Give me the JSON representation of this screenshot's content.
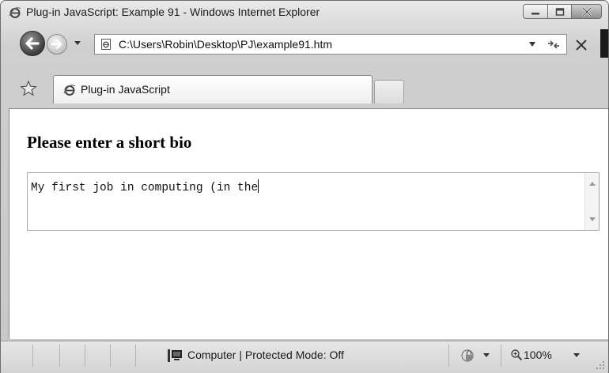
{
  "window": {
    "title": "Plug-in JavaScript: Example 91 - Windows Internet Explorer",
    "icon": "ie-icon",
    "buttons": [
      "minimize-icon",
      "maximize-icon",
      "close-icon"
    ]
  },
  "nav": {
    "back_icon": "back-arrow-icon",
    "forward_icon": "forward-arrow-icon",
    "address": "C:\\Users\\Robin\\Desktop\\PJ\\example91.htm",
    "refresh_icon": "refresh-icon",
    "stop_icon": "stop-icon"
  },
  "tabs": {
    "favorites_icon": "favorites-star-icon",
    "items": [
      {
        "label": "Plug-in JavaScript",
        "icon": "ie-page-icon",
        "active": true
      }
    ],
    "new_tab": ""
  },
  "page": {
    "heading": "Please enter a short bio",
    "bio_value": "My first job in computing (in the"
  },
  "statusbar": {
    "zone_icon": "computer-icon",
    "zone_text": "Computer | Protected Mode: Off",
    "security_icon": "security-lock-icon",
    "zoom_icon": "zoom-icon",
    "zoom": "100%"
  },
  "colors": {
    "chrome": "#d0d0d0",
    "page_background": "#ffffff",
    "text": "#000000"
  }
}
